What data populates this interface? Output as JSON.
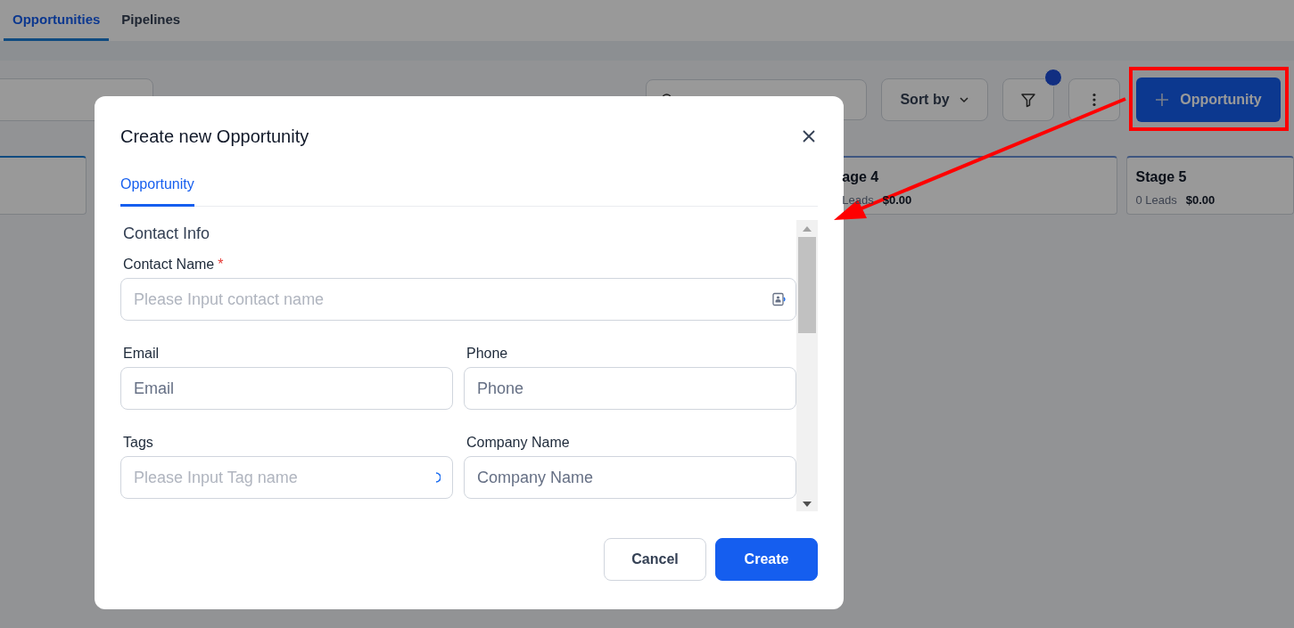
{
  "tabs": [
    {
      "label": "Opportunities",
      "selected": true
    },
    {
      "label": "Pipelines",
      "selected": false
    }
  ],
  "toolbar": {
    "sort_button": "Sort by",
    "filter_active": true,
    "add_button": "Opportunity"
  },
  "stages": [
    {
      "kind": "blank"
    },
    {
      "kind": "stage",
      "name": "age 4",
      "leads": "Leads",
      "value": "$0.00"
    },
    {
      "kind": "stage",
      "name": "Stage 5",
      "leads": "0 Leads",
      "value": "$0.00"
    }
  ],
  "modal": {
    "title": "Create new Opportunity",
    "tabs": [
      {
        "label": "Opportunity",
        "selected": true
      }
    ],
    "section": "Contact Info",
    "fields": [
      {
        "kind": "contact",
        "label": "Contact Name",
        "required_mark": "*",
        "placeholder": "Please Input contact name"
      },
      {
        "kind": "text",
        "label": "Email",
        "placeholder": "Email"
      },
      {
        "kind": "text",
        "label": "Phone",
        "placeholder": "Phone"
      },
      {
        "kind": "tags",
        "label": "Tags",
        "placeholder": "Please Input Tag name"
      },
      {
        "kind": "text",
        "label": "Company Name",
        "placeholder": "Company Name"
      }
    ],
    "buttons": [
      {
        "kind": "secondary",
        "label": "Cancel"
      },
      {
        "kind": "primary",
        "label": "Create"
      }
    ]
  }
}
